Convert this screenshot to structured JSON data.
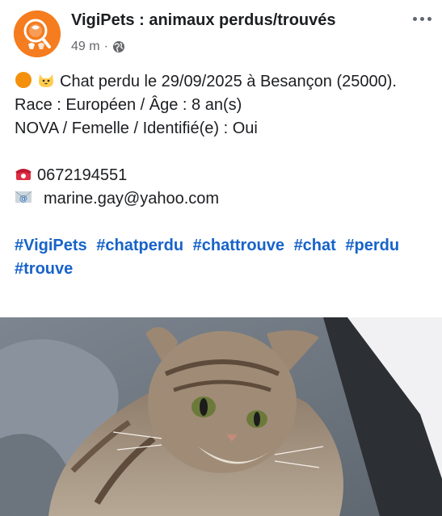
{
  "header": {
    "page_name": "VigiPets : animaux perdus/trouvés",
    "time": "49 m",
    "separator": "·",
    "privacy_icon": "globe-icon",
    "more_icon": "more-options-icon"
  },
  "post": {
    "line1": "Chat perdu le 29/09/2025 à Besançon (25000).",
    "line2": "Race : Européen / Âge : 8 an(s)",
    "line3": "NOVA / Femelle / Identifié(e) : Oui",
    "phone": "0672194551",
    "email": "marine.gay@yahoo.com",
    "hashtags": [
      "#VigiPets",
      "#chatperdu",
      "#chattrouve",
      "#chat",
      "#perdu",
      "#trouve"
    ],
    "icons": [
      "orange-circle-icon",
      "cat-face-icon",
      "telephone-icon",
      "email-icon"
    ]
  },
  "photo": {
    "subject": "tabby cat on grey blanket"
  },
  "colors": {
    "hashtag": "#1763c9",
    "brand_orange": "#f57c1f",
    "meta_gray": "#65676b"
  }
}
